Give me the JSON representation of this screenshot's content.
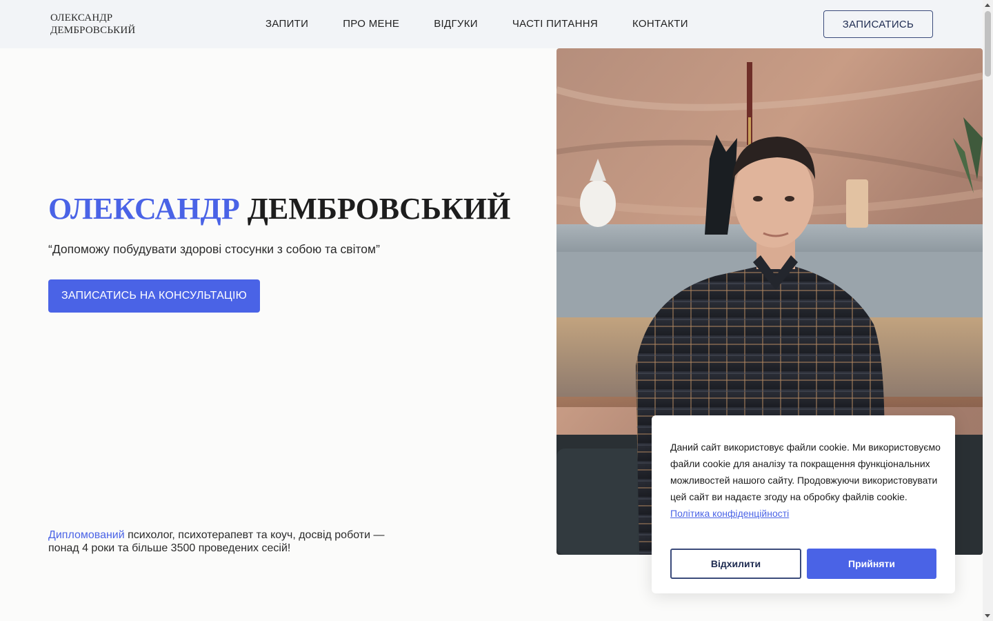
{
  "header": {
    "logo_line1": "ОЛЕКСАНДР",
    "logo_line2": "ДЕМБРОВСЬКИЙ",
    "nav": [
      {
        "label": "ЗАПИТИ"
      },
      {
        "label": "ПРО МЕНЕ"
      },
      {
        "label": "ВІДГУКИ"
      },
      {
        "label": "ЧАСТІ ПИТАННЯ"
      },
      {
        "label": "КОНТАКТИ"
      }
    ],
    "cta_label": "ЗАПИСАТИСЬ"
  },
  "hero": {
    "first_name": "ОЛЕКСАНДР",
    "last_name": "ДЕМБРОВСЬКИЙ",
    "quote": "“Допоможу побудувати здорові стосунки з собою та світом”",
    "button_label": "ЗАПИСАТИСЬ НА КОНСУЛЬТАЦІЮ",
    "bio_accent": "Дипломований",
    "bio_rest_line1": " психолог, психотерапевт та коуч, досвід роботи —",
    "bio_line2": "понад 4 роки та більше 3500 проведених сесій!"
  },
  "cookie": {
    "text": "Даний сайт використовує файли cookie. Ми використовуємо файли cookie для аналізу та покращення функціональних можливостей нашого сайту. Продовжуючи використовувати цей сайт ви надаєте згоду на обробку файлів cookie.",
    "policy_link": "Політика конфіденційності",
    "decline_label": "Відхилити",
    "accept_label": "Прийняти"
  },
  "colors": {
    "accent": "#4a63e6",
    "header_bg": "#f2f4f7",
    "page_bg": "#fbfbfa"
  }
}
